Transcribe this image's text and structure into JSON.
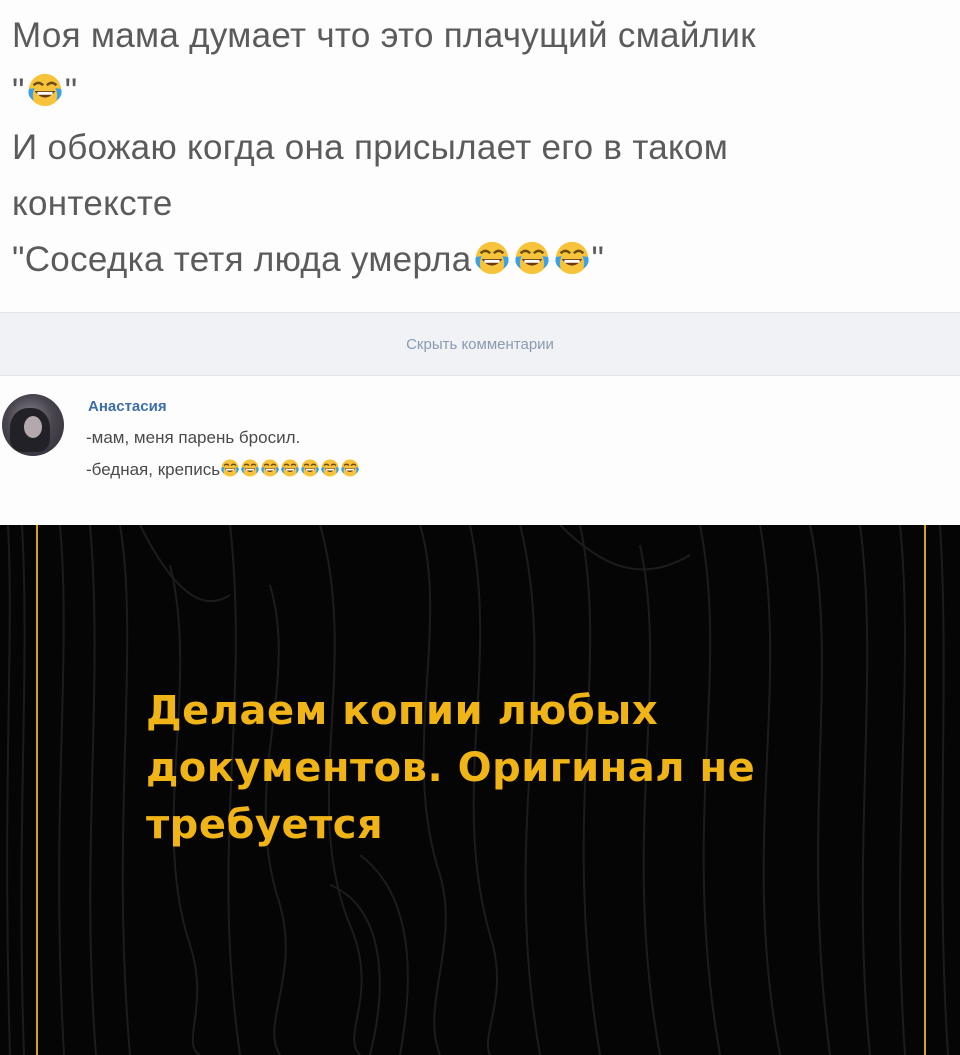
{
  "post": {
    "line1": "Моя мама думает что это плачущий смайлик",
    "line2_open": "\"",
    "line2_close": "\"",
    "line3": "И обожаю когда она присылает его в таком",
    "line4": "контексте",
    "line5_text": "\"Соседка тетя люда умерла",
    "line5_close": "\"",
    "emoji_icon": "face-with-tears-of-joy"
  },
  "hide_comments": {
    "label": "Скрыть комментарии"
  },
  "comment": {
    "author": "Анастасия",
    "line1": "-мам, меня парень бросил.",
    "line2": "-бедная, крепись",
    "emoji_count": 7
  },
  "ad": {
    "text": "Делаем копии любых документов. Оригинал не требуется",
    "colors": {
      "background": "#050505",
      "accent": "#f0b417"
    }
  }
}
